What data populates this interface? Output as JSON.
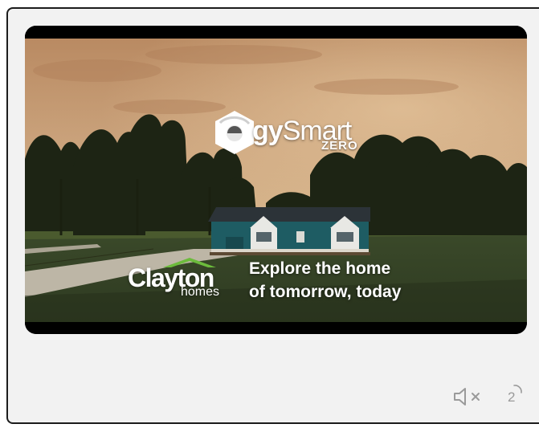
{
  "ad": {
    "product_brand_prefix": "",
    "product_brand_main": "gy",
    "product_brand_light": "Smart",
    "product_brand_sub": "ZERO",
    "company_name": "Clayton",
    "company_sub": "homes",
    "tagline_line1": "Explore the home",
    "tagline_line2": "of tomorrow, today"
  },
  "controls": {
    "mute_icon": "speaker-muted-icon",
    "countdown": "2"
  },
  "colors": {
    "frame_bg": "#f2f2f2",
    "frame_border": "#1c1c1c",
    "icon_gray": "#9a9a9a",
    "house_teal": "#1e5c63",
    "corner_accent": "#19a8c7"
  }
}
